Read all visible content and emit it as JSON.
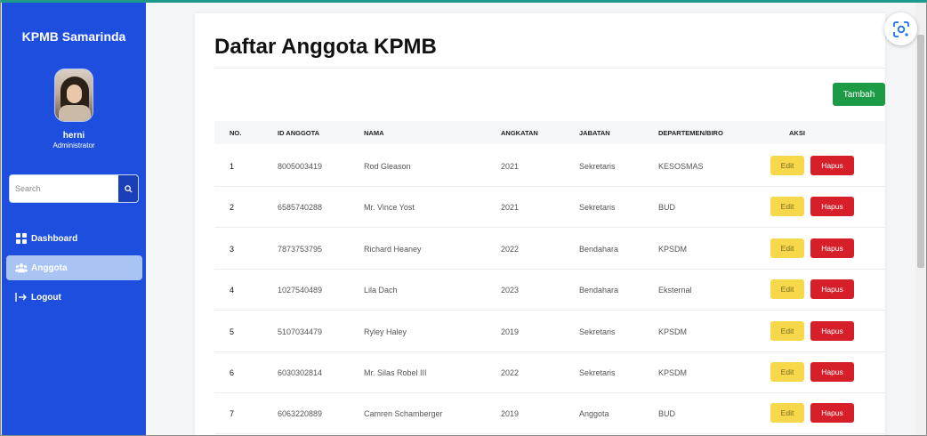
{
  "sidebar": {
    "brand": "KPMB Samarinda",
    "user": {
      "name": "herni",
      "role": "Administrator"
    },
    "search": {
      "placeholder": "Search",
      "icon": "search-icon"
    },
    "nav": [
      {
        "label": "Dashboard",
        "icon": "grid-icon",
        "active": false
      },
      {
        "label": "Anggota",
        "icon": "users-icon",
        "active": true
      },
      {
        "label": "Logout",
        "icon": "logout-icon",
        "active": false
      }
    ]
  },
  "main": {
    "title": "Daftar Anggota KPMB",
    "add_label": "Tambah",
    "table": {
      "headers": [
        "NO.",
        "ID ANGGOTA",
        "NAMA",
        "ANGKATAN",
        "JABATAN",
        "DEPARTEMEN/BIRO",
        "AKSI"
      ],
      "edit_label": "Edit",
      "delete_label": "Hapus",
      "rows": [
        {
          "no": "1",
          "id": "8005003419",
          "nama": "Rod Gleason",
          "angkatan": "2021",
          "jabatan": "Sekretaris",
          "departemen": "KESOSMAS"
        },
        {
          "no": "2",
          "id": "6585740288",
          "nama": "Mr. Vince Yost",
          "angkatan": "2021",
          "jabatan": "Sekretaris",
          "departemen": "BUD"
        },
        {
          "no": "3",
          "id": "7873753795",
          "nama": "Richard Heaney",
          "angkatan": "2022",
          "jabatan": "Bendahara",
          "departemen": "KPSDM"
        },
        {
          "no": "4",
          "id": "1027540489",
          "nama": "Lila Dach",
          "angkatan": "2023",
          "jabatan": "Bendahara",
          "departemen": "Eksternal"
        },
        {
          "no": "5",
          "id": "5107034479",
          "nama": "Ryley Haley",
          "angkatan": "2019",
          "jabatan": "Sekretaris",
          "departemen": "KPSDM"
        },
        {
          "no": "6",
          "id": "6030302814",
          "nama": "Mr. Silas Robel III",
          "angkatan": "2022",
          "jabatan": "Sekretaris",
          "departemen": "KPSDM"
        },
        {
          "no": "7",
          "id": "6063220889",
          "nama": "Camren Schamberger",
          "angkatan": "2019",
          "jabatan": "Anggota",
          "departemen": "BUD"
        }
      ]
    }
  },
  "colors": {
    "sidebar": "#1d4ede",
    "active_nav": "#a9c3f3",
    "add_button": "#1c9a45",
    "edit_button": "#f6d84a",
    "delete_button": "#d71f2a"
  },
  "overlay": {
    "icon": "lens-icon"
  }
}
